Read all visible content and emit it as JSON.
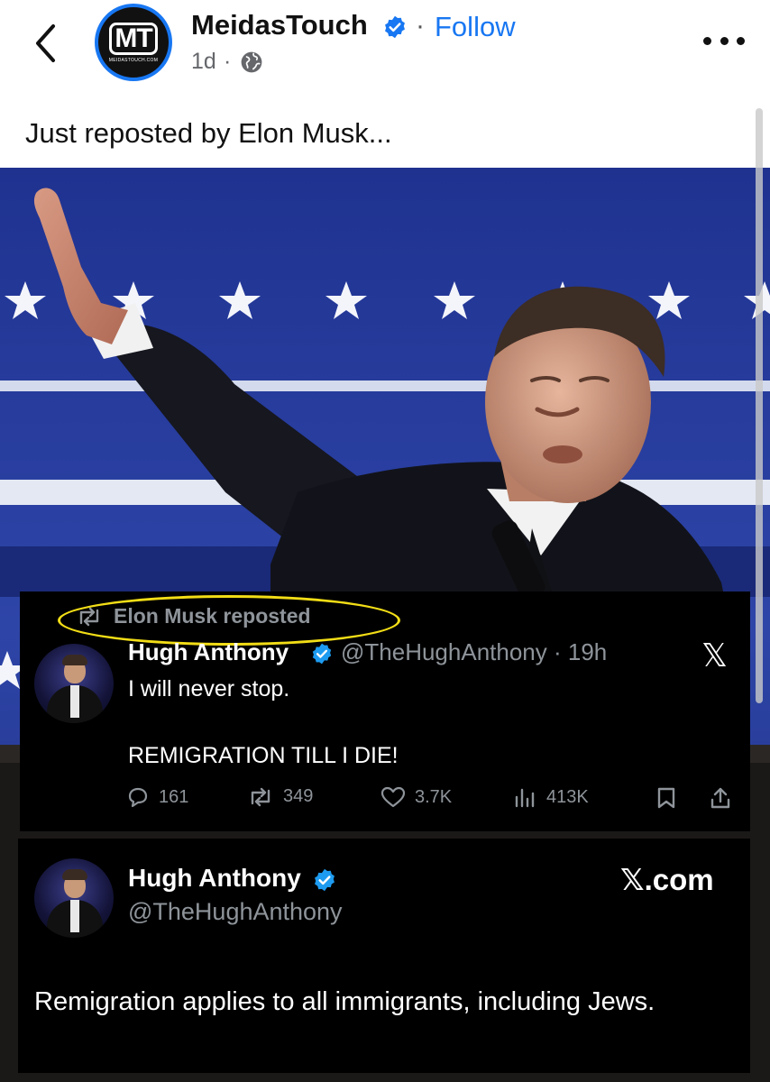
{
  "header": {
    "page_name": "MeidasTouch",
    "avatar_text": "MT",
    "avatar_subtext": "MEIDASTOUCH.COM",
    "follow_separator": "·",
    "follow_label": "Follow",
    "post_age": "1d",
    "time_separator": "·"
  },
  "post": {
    "caption": "Just reposted by Elon Musk..."
  },
  "tweet1": {
    "repost_label": "Elon Musk reposted",
    "author_name": "Hugh Anthony",
    "author_handle_time": "@TheHughAnthony · 19h",
    "x_logo": "𝕏",
    "line1": "I will never stop.",
    "line2": "REMIGRATION TILL I DIE!",
    "replies": "161",
    "reposts": "349",
    "likes": "3.7K",
    "views": "413K"
  },
  "tweet2": {
    "author_name": "Hugh Anthony",
    "author_handle": "@TheHughAnthony",
    "source": "𝕏.com",
    "body": "Remigration applies to all immigrants, including Jews."
  },
  "colors": {
    "facebook_blue": "#1877f2",
    "twitter_verified": "#1d9bf0",
    "highlight_yellow": "#f2dd16",
    "flag_blue": "#2a3fa0"
  },
  "icons": [
    "back-chevron-icon",
    "verified-badge-icon",
    "globe-icon",
    "more-dots-icon",
    "repost-icon",
    "reply-icon",
    "like-icon",
    "views-icon",
    "bookmark-icon",
    "share-icon"
  ]
}
